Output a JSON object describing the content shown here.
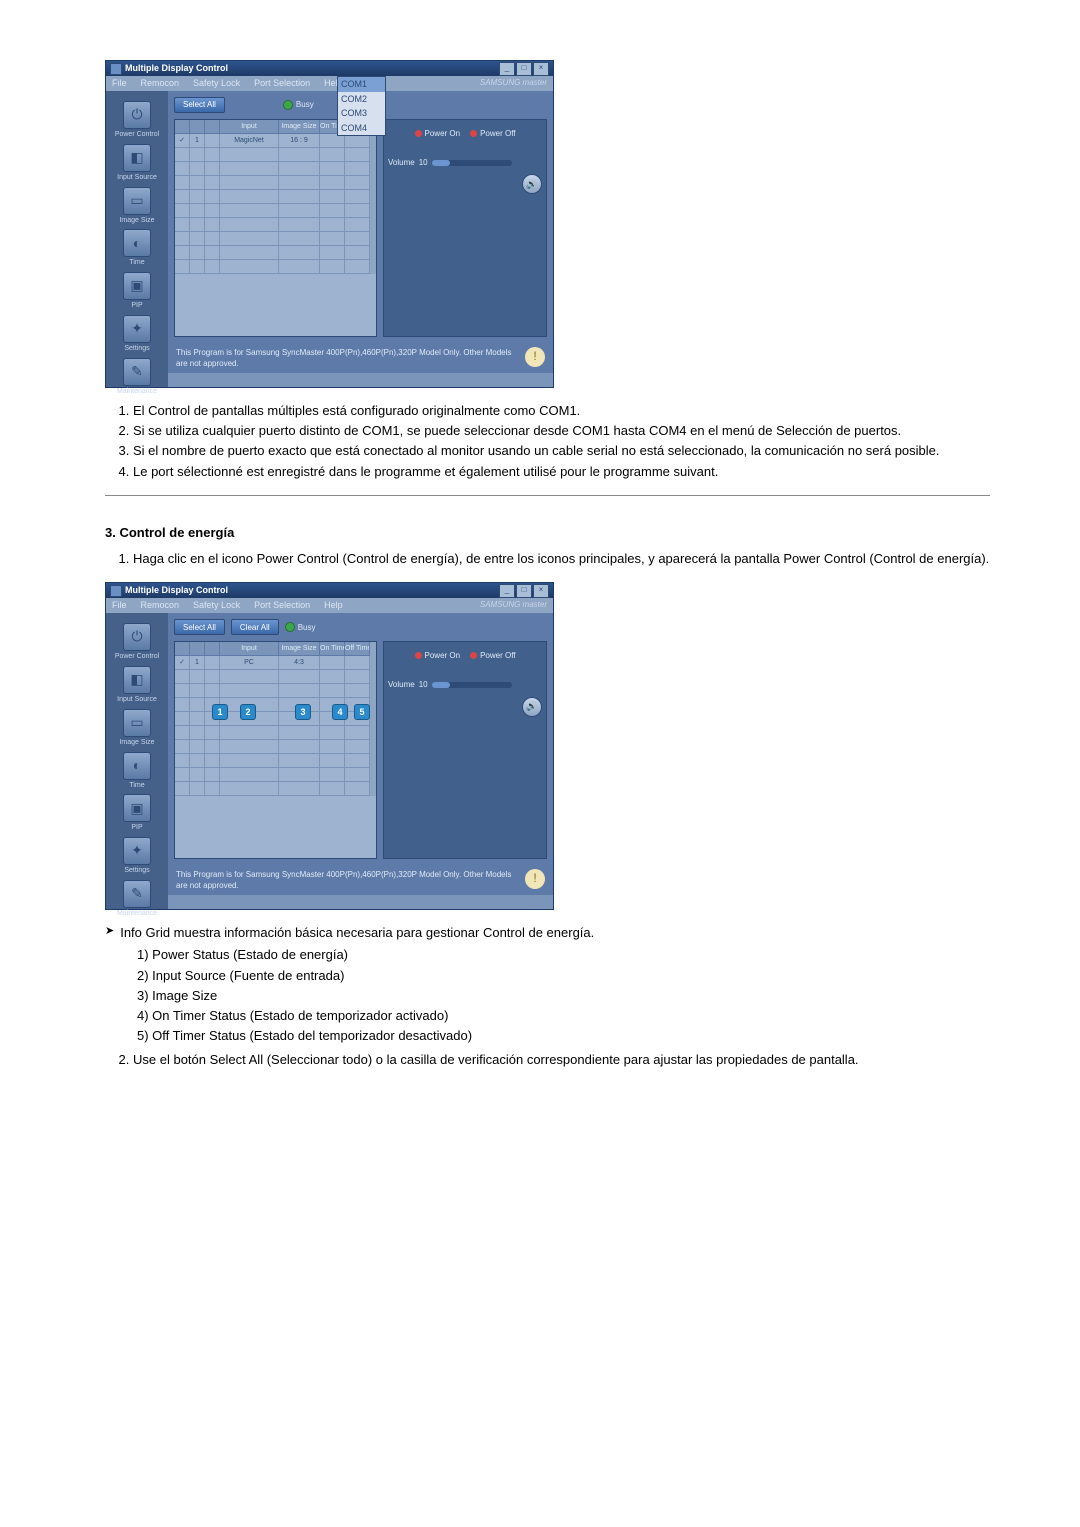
{
  "app": {
    "title": "Multiple Display Control",
    "menus": [
      "File",
      "Remocon",
      "Safety Lock",
      "Port Selection",
      "Help"
    ],
    "brand": "SAMSUNG master",
    "port_dropdown": [
      "COM1",
      "COM2",
      "COM3",
      "COM4"
    ],
    "sidebar": [
      {
        "label": "Power Control",
        "glyph": "⏻"
      },
      {
        "label": "Input Source",
        "glyph": "◧"
      },
      {
        "label": "Image Size",
        "glyph": "▭"
      },
      {
        "label": "Time",
        "glyph": "◐"
      },
      {
        "label": "PIP",
        "glyph": "▣"
      },
      {
        "label": "Settings",
        "glyph": "✦"
      },
      {
        "label": "Maintenance",
        "glyph": "✎"
      }
    ],
    "buttons": {
      "select_all": "Select All",
      "clear_all": "Clear All"
    },
    "busy_label": "Busy",
    "grid_headers_a": [
      "",
      "",
      "",
      "Input",
      "Image Size",
      "On Timer",
      "Off Timer"
    ],
    "row_a": [
      "✓",
      "1",
      "",
      "MagicNet",
      "16 : 9",
      "",
      ""
    ],
    "grid_headers_b": [
      "",
      "",
      "",
      "Input",
      "Image Size",
      "On Timer",
      "Off Timer"
    ],
    "row_b": [
      "✓",
      "1",
      "",
      "PC",
      "4:3",
      "",
      ""
    ],
    "power_on": "Power On",
    "power_off": "Power Off",
    "volume_label": "Volume",
    "volume_value": "10",
    "footer": "This Program is for Samsung SyncMaster 400P(Pn),460P(Pn),320P  Model Only. Other Models are not approved."
  },
  "section1_list": [
    "El Control de pantallas múltiples está configurado originalmente como COM1.",
    "Si se utiliza cualquier puerto distinto de COM1, se puede seleccionar desde COM1 hasta COM4 en el menú de Selección de puertos.",
    "Si el nombre de puerto exacto que está conectado al monitor usando un cable serial no está seleccionado, la comunicación no será posible.",
    "Le port sélectionné est enregistré dans le programme et également utilisé pour le programme suivant."
  ],
  "section2": {
    "title": "3. Control de energía",
    "intro": "Haga clic en el icono Power Control (Control de energía), de entre los iconos principales, y aparecerá la pantalla Power Control (Control de energía).",
    "info_grid": "Info Grid muestra información básica necesaria para gestionar Control de energía.",
    "items": [
      "1) Power Status (Estado de energía)",
      "2) Input Source (Fuente de entrada)",
      "3) Image Size",
      "4) On Timer Status (Estado de temporizador activado)",
      "5) Off Timer Status (Estado del temporizador desactivado)"
    ],
    "item2": "Use el botón Select All (Seleccionar todo) o la casilla de verificación correspondiente para ajustar las propiedades de pantalla."
  }
}
